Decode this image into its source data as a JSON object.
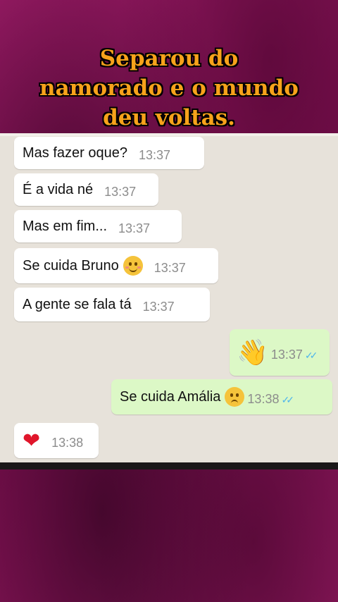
{
  "headline": {
    "line1": "Separou do",
    "line2": "namorado  e o mundo",
    "line3": "deu  voltas."
  },
  "messages": [
    {
      "text": "Mas fazer oque?",
      "time": "13:37"
    },
    {
      "text": "É a vida né",
      "time": "13:37"
    },
    {
      "text": "Mas em fim...",
      "time": "13:37"
    },
    {
      "text": "Se cuida Bruno",
      "emoji": "relieved-smile",
      "time": "13:37"
    },
    {
      "text": "A gente se fala tá",
      "time": "13:37"
    },
    {
      "emoji": "waving-hand",
      "time": "13:37",
      "status": "read"
    },
    {
      "text": "Se cuida Amália",
      "emoji": "slightly-frowning-face",
      "time": "13:38",
      "status": "read"
    },
    {
      "emoji": "red-heart",
      "time": "13:38"
    }
  ],
  "colors": {
    "background": "#8a1659",
    "headline": "#f7a21b",
    "incoming_bubble": "#ffffff",
    "outgoing_bubble": "#dcf8c6",
    "read_ticks": "#4fb6ec",
    "chat_wallpaper": "#e7e2da"
  }
}
